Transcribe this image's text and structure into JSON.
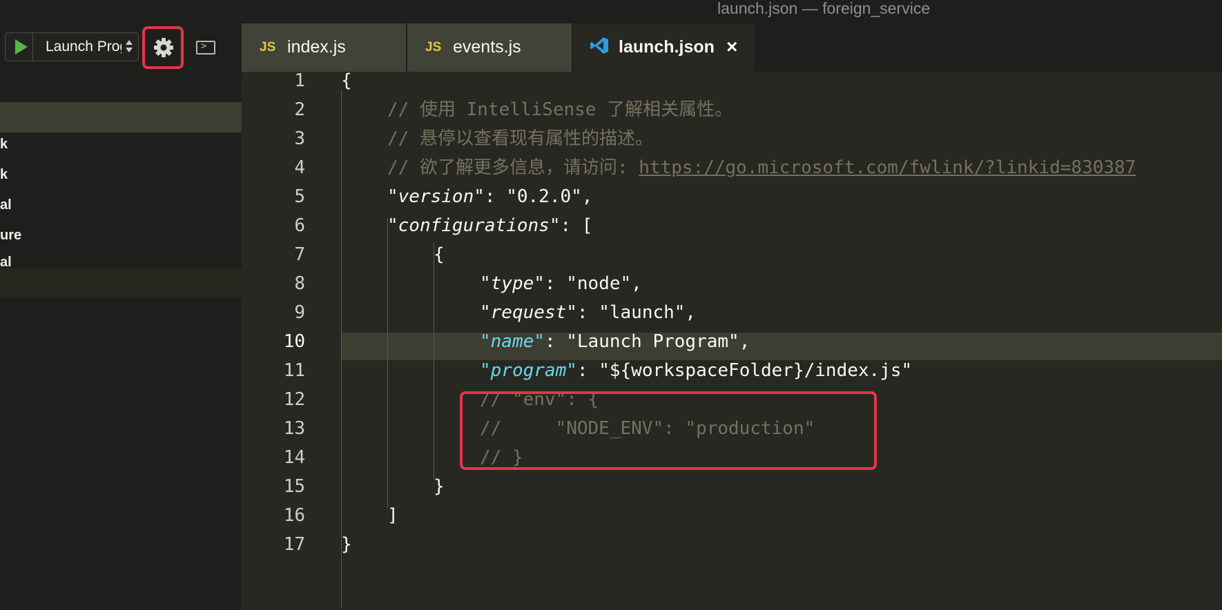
{
  "window": {
    "title": "launch.json — foreign_service"
  },
  "debug_toolbar": {
    "config_select_value": "Launch Program",
    "colors": {
      "play": "#56b64b",
      "highlight_box": "#e8344a"
    }
  },
  "sidebar": {
    "items": [
      "k",
      "k",
      "al",
      "ure",
      "al"
    ]
  },
  "tabs": [
    {
      "icon": "JS",
      "label": "index.js",
      "active": false
    },
    {
      "icon": "JS",
      "label": "events.js",
      "active": false
    },
    {
      "icon": "vscode-icon",
      "label": "launch.json",
      "active": true,
      "close": "×"
    }
  ],
  "editor": {
    "line_numbers": [
      "1",
      "2",
      "3",
      "4",
      "5",
      "6",
      "7",
      "8",
      "9",
      "10",
      "11",
      "12",
      "13",
      "14",
      "15",
      "16",
      "17"
    ],
    "current_line": "10",
    "lines": {
      "l1": {
        "brace": "{"
      },
      "l2": {
        "comment": "// 使用 IntelliSense 了解相关属性。"
      },
      "l3": {
        "comment": "// 悬停以查看现有属性的描述。"
      },
      "l4": {
        "comment": "// 欲了解更多信息，请访问: ",
        "url": "https://go.microsoft.com/fwlink/?linkid=830387"
      },
      "l5": {
        "key": "version",
        "value": "\"0.2.0\","
      },
      "l6": {
        "key": "configurations",
        "value": "["
      },
      "l7": {
        "brace": "{"
      },
      "l8": {
        "key": "type",
        "value": "\"node\","
      },
      "l9": {
        "key": "request",
        "value": "\"launch\","
      },
      "l10": {
        "key": "name",
        "value": "\"Launch Program\","
      },
      "l11": {
        "key": "program",
        "value": "\"${workspaceFolder}/index.js\""
      },
      "l12": {
        "comment": "// \"env\": {"
      },
      "l13": {
        "comment": "//     \"NODE_ENV\": \"production\""
      },
      "l14": {
        "comment": "// }"
      },
      "l15": {
        "brace": "}"
      },
      "l16": {
        "brace": "]"
      },
      "l17": {
        "brace": "}"
      }
    }
  }
}
